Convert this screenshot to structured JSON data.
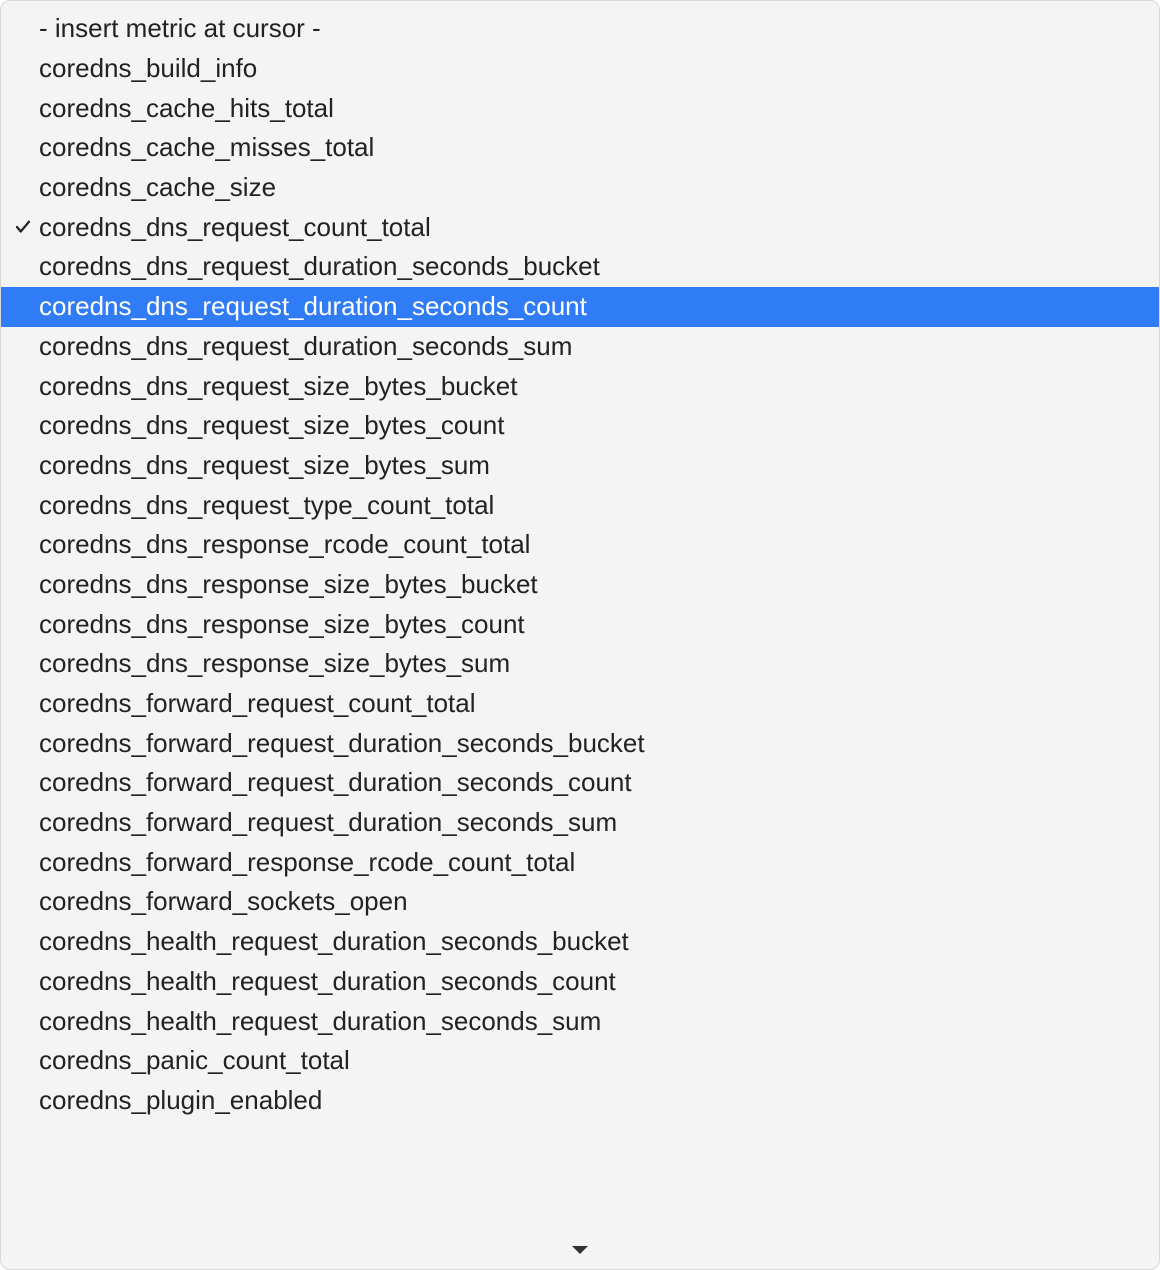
{
  "dropdown": {
    "checked_index": 5,
    "highlighted_index": 7,
    "options": [
      "- insert metric at cursor -",
      "coredns_build_info",
      "coredns_cache_hits_total",
      "coredns_cache_misses_total",
      "coredns_cache_size",
      "coredns_dns_request_count_total",
      "coredns_dns_request_duration_seconds_bucket",
      "coredns_dns_request_duration_seconds_count",
      "coredns_dns_request_duration_seconds_sum",
      "coredns_dns_request_size_bytes_bucket",
      "coredns_dns_request_size_bytes_count",
      "coredns_dns_request_size_bytes_sum",
      "coredns_dns_request_type_count_total",
      "coredns_dns_response_rcode_count_total",
      "coredns_dns_response_size_bytes_bucket",
      "coredns_dns_response_size_bytes_count",
      "coredns_dns_response_size_bytes_sum",
      "coredns_forward_request_count_total",
      "coredns_forward_request_duration_seconds_bucket",
      "coredns_forward_request_duration_seconds_count",
      "coredns_forward_request_duration_seconds_sum",
      "coredns_forward_response_rcode_count_total",
      "coredns_forward_sockets_open",
      "coredns_health_request_duration_seconds_bucket",
      "coredns_health_request_duration_seconds_count",
      "coredns_health_request_duration_seconds_sum",
      "coredns_panic_count_total",
      "coredns_plugin_enabled"
    ]
  }
}
